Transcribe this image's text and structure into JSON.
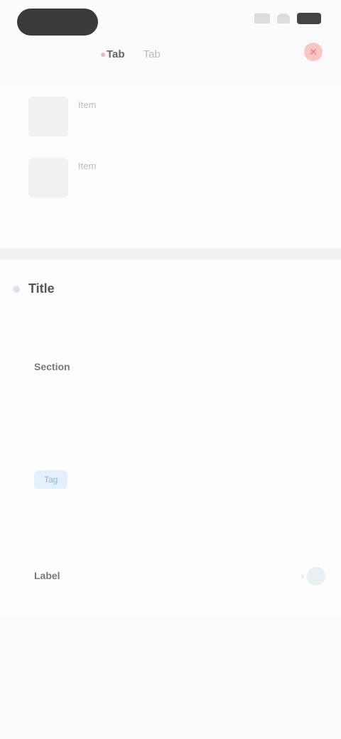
{
  "status": {
    "time": "",
    "icons": [
      "signal-icon",
      "wifi-icon",
      "battery-icon"
    ]
  },
  "tabs": [
    {
      "label": "Tab",
      "active": true
    },
    {
      "label": "Tab",
      "active": false
    }
  ],
  "close_icon": "close-icon",
  "list": [
    {
      "name": "Item",
      "sub": "",
      "right": ""
    },
    {
      "name": "Item",
      "sub": "",
      "right": ""
    }
  ],
  "detail": {
    "title": "Title",
    "paragraph": "",
    "section_label": "Section",
    "bullets": [
      "",
      ""
    ],
    "tag": "Tag",
    "tag_text": "",
    "meta_label": "",
    "meta_value": "",
    "footer_label": "Label",
    "footer_chevron": "›"
  },
  "bottom": {
    "small_text": ""
  },
  "colors": {
    "background": "#fbfbfb",
    "accent": "#8cb6da",
    "danger": "#e77"
  }
}
